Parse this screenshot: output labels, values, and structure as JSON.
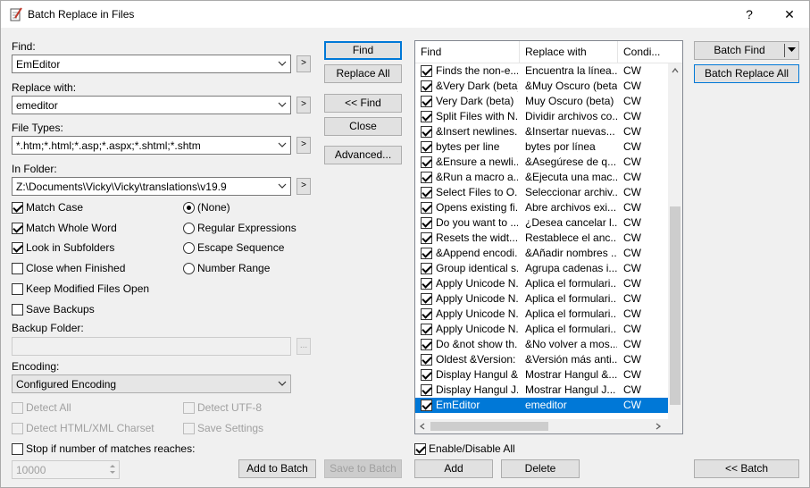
{
  "window": {
    "title": "Batch Replace in Files",
    "help": "?",
    "close": "✕"
  },
  "find": {
    "label": "Find:",
    "value": "EmEditor"
  },
  "replace": {
    "label": "Replace with:",
    "value": "emeditor"
  },
  "filetypes": {
    "label": "File Types:",
    "value": "*.htm;*.html;*.asp;*.aspx;*.shtml;*.shtm"
  },
  "folder": {
    "label": "In Folder:",
    "value": "Z:\\Documents\\Vicky\\Vicky\\translations\\v19.9"
  },
  "arrow_button": ">",
  "options": {
    "match_case": "Match Case",
    "match_whole_word": "Match Whole Word",
    "look_in_subfolders": "Look in Subfolders",
    "close_when_finished": "Close when Finished",
    "keep_modified": "Keep Modified Files Open",
    "save_backups": "Save Backups"
  },
  "modes": {
    "none": "(None)",
    "regex": "Regular Expressions",
    "escape": "Escape Sequence",
    "number_range": "Number Range"
  },
  "backup": {
    "label": "Backup Folder:",
    "browse": "..."
  },
  "encoding": {
    "label": "Encoding:",
    "value": "Configured Encoding",
    "detect_all": "Detect All",
    "detect_utf8": "Detect UTF-8",
    "detect_charset": "Detect HTML/XML Charset",
    "save_settings": "Save Settings"
  },
  "stop": {
    "label": "Stop if number of matches reaches:",
    "value": "10000"
  },
  "buttons": {
    "find": "Find",
    "replace_all": "Replace All",
    "back_find": "<< Find",
    "close": "Close",
    "advanced": "Advanced...",
    "add_to_batch": "Add to Batch",
    "save_to_batch": "Save to Batch",
    "batch_find": "Batch Find",
    "batch_replace_all": "Batch Replace All",
    "back_batch": "<< Batch",
    "add": "Add",
    "delete": "Delete",
    "enable_disable_all": "Enable/Disable All"
  },
  "table": {
    "headers": [
      "Find",
      "Replace with",
      "Condi..."
    ],
    "rows": [
      [
        "Finds the non-e...",
        "Encuentra la línea...",
        "CW"
      ],
      [
        "&Very Dark (beta)",
        "&Muy Oscuro (beta)",
        "CW"
      ],
      [
        "Very Dark (beta)",
        "Muy Oscuro (beta)",
        "CW"
      ],
      [
        "Split Files with N...",
        "Dividir archivos co...",
        "CW"
      ],
      [
        "&Insert newlines...",
        "&Insertar nuevas...",
        "CW"
      ],
      [
        "bytes per line",
        "bytes por línea",
        "CW"
      ],
      [
        "&Ensure a newli...",
        "&Asegúrese de q...",
        "CW"
      ],
      [
        "&Run a macro a...",
        "&Ejecuta una mac...",
        "CW"
      ],
      [
        "Select Files to O...",
        "Seleccionar archiv...",
        "CW"
      ],
      [
        "Opens existing fi...",
        "Abre archivos exi...",
        "CW"
      ],
      [
        "Do you want to ...",
        "¿Desea cancelar l...",
        "CW"
      ],
      [
        "Resets the widt...",
        "Restablece el anc...",
        "CW"
      ],
      [
        "&Append encodi...",
        "&Añadir nombres ...",
        "CW"
      ],
      [
        "Group identical s...",
        "Agrupa cadenas i...",
        "CW"
      ],
      [
        "Apply Unicode N...",
        "Aplica el formulari...",
        "CW"
      ],
      [
        "Apply Unicode N...",
        "Aplica el formulari...",
        "CW"
      ],
      [
        "Apply Unicode N...",
        "Aplica el formulari...",
        "CW"
      ],
      [
        "Apply Unicode N...",
        "Aplica el formulari...",
        "CW"
      ],
      [
        "Do &not show th...",
        "&No volver a mos...",
        "CW"
      ],
      [
        "Oldest &Version:",
        "&Versión más anti...",
        "CW"
      ],
      [
        "Display Hangul &...",
        "Mostrar Hangul &...",
        "CW"
      ],
      [
        "Display Hangul J...",
        "Mostrar Hangul J...",
        "CW"
      ],
      [
        "EmEditor",
        "emeditor",
        "CW"
      ]
    ]
  }
}
